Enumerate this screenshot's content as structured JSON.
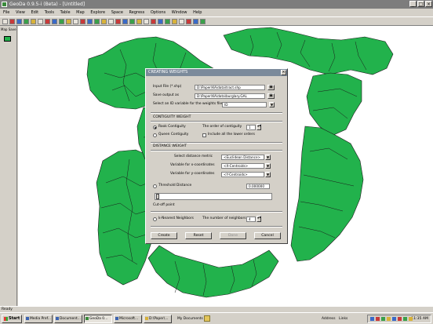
{
  "window": {
    "title": "GeoDa 0.9.5-i (Beta) - [Untitled]",
    "min": "_",
    "max": "□",
    "close": "×"
  },
  "menu": [
    "File",
    "View",
    "Edit",
    "Tools",
    "Table",
    "Map",
    "Explore",
    "Space",
    "Regress",
    "Options",
    "Window",
    "Help"
  ],
  "left_panel": {
    "label": "Map Save"
  },
  "map": {
    "fill": "#22b24c",
    "stroke": "#1a1a1a"
  },
  "dialog": {
    "title": "CREATING WEIGHTS",
    "input_label": "Input File (*.shp)",
    "input_value": "D:\\Paper\\KA\\data\\tract.shp",
    "save_label": "Save output as",
    "save_value": "D:\\Paper\\KA\\data\\burglary.GAL",
    "id_label": "Select an ID variable for the weights file",
    "id_value": "ID",
    "contiguity_header": "CONTIGUITY WEIGHT",
    "rook": "Rook Contiguity",
    "queen": "Queen Contiguity",
    "order_label": "The order of contiguity",
    "order_value": "1",
    "include_lower": "Include all the lower orders",
    "distance_header": "DISTANCE WEIGHT",
    "metric_label": "Select distance metric",
    "metric_value": "<Euclidean Distance>",
    "xvar_label": "Variable for x-coordinates",
    "xvar_value": "<X-Centroids>",
    "yvar_label": "Variable for y-coordinates",
    "yvar_value": "<Y-Centroids>",
    "threshold_label": "Threshold Distance",
    "threshold_value": "0.000000",
    "cutoff_label": "Cut-off point",
    "knn_label": "k-Nearest Neighbors",
    "nn_label": "The number of neighbors",
    "nn_value": "4",
    "buttons": {
      "create": "Create",
      "reset": "Reset",
      "done": "Done",
      "cancel": "Cancel"
    }
  },
  "status": {
    "text": "Ready"
  },
  "taskbar": {
    "start": "Start",
    "tasks": [
      "Media Pref...",
      "Document...",
      "GeoDa 0...",
      "Microsoft...",
      "D:\\Paper\\...",
      "My Documents"
    ],
    "address": "Address",
    "links": "Links",
    "clock": "11:35 AM"
  }
}
